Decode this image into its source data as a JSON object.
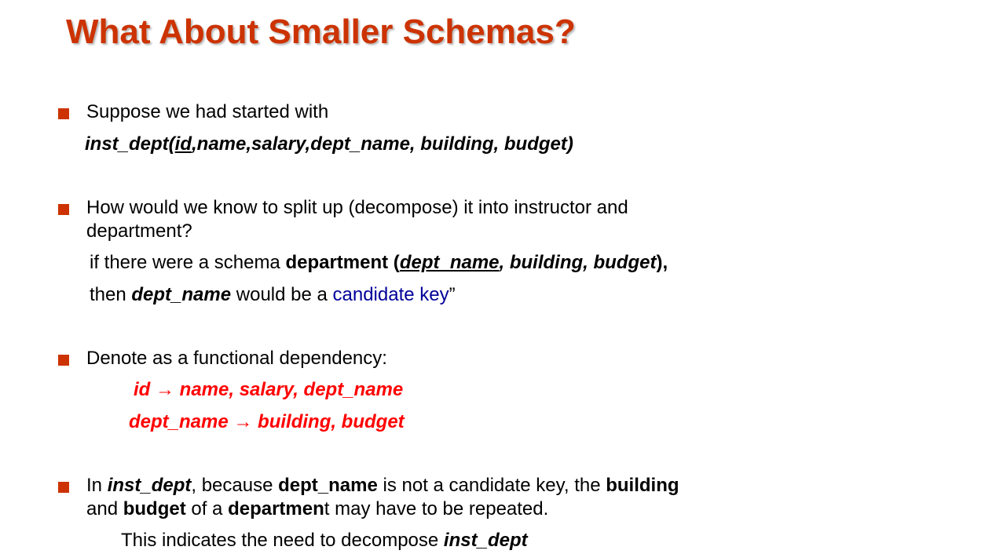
{
  "slide": {
    "title": "What About Smaller Schemas?",
    "colors": {
      "title": "#cc3300",
      "bullet": "#cc3300",
      "candidate_key": "#000099",
      "fd": "#ff0000"
    },
    "bullet1": {
      "line1": "Suppose we had started with",
      "schema_pre": "inst_dept(",
      "schema_key": "id",
      "schema_post": ",name,salary,dept_name, building, budget)"
    },
    "bullet2": {
      "line1": "How would we know to split up (decompose) it into instructor  and",
      "line2": "department?",
      "if_text": "if   there were a schema ",
      "dept_bold": "department (",
      "dept_key": "dept_name",
      "dept_attrs": ", building, budget",
      "dept_close": "),",
      "then_text": "then ",
      "then_bold": "dept_name",
      "then_mid": " would be a ",
      "candidate_key": "candidate key",
      "then_end": "”"
    },
    "bullet3": {
      "line1": "Denote as a functional dependency:",
      "fd1_left": "id ",
      "fd1_arrow": "→",
      "fd1_right": " name, salary, dept_name",
      "fd2_left": "dept_name ",
      "fd2_arrow": "→",
      "fd2_right": " building, budget"
    },
    "bullet4": {
      "in_text": "In ",
      "in_bold": "inst_dept",
      "because_text": ", because ",
      "because_bold": "dept_name",
      "mid_text": " is not a candidate key, the ",
      "building_bold": "building",
      "and_text": "and ",
      "budget_bold": "budget",
      "of_text": " of a ",
      "department_bold": "departmen",
      "rest_text": "t may have to be repeated.",
      "indicates_text": "This indicates the need to decompose ",
      "indicates_bold": "inst_dept"
    }
  }
}
